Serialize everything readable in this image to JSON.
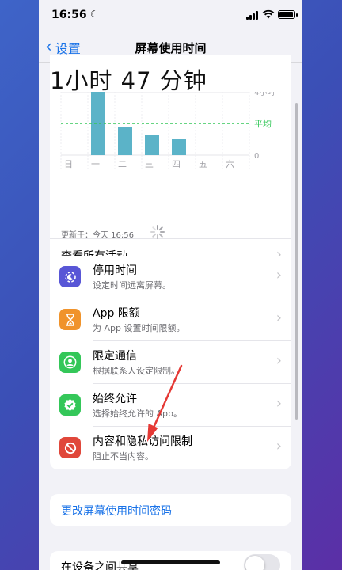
{
  "status_bar": {
    "time": "16:56",
    "moon": "☾"
  },
  "nav": {
    "back_label": "设置",
    "title": "屏幕使用时间"
  },
  "summary": {
    "total_time": "1小时 47 分钟",
    "see_all": "查看所有活动",
    "updated": "更新于：今天 16:56"
  },
  "chart_data": {
    "type": "bar",
    "categories": [
      "日",
      "一",
      "二",
      "三",
      "四",
      "五",
      "六"
    ],
    "values": [
      0,
      4,
      1.75,
      1.25,
      1.0,
      0,
      0
    ],
    "ylim": [
      0,
      4
    ],
    "yticks": [
      "4小时",
      "0"
    ],
    "average_label": "平均",
    "average_value": 2.0,
    "bar_color": "#5bb3c8",
    "average_color": "#34c759"
  },
  "menu": [
    {
      "title": "停用时间",
      "subtitle": "设定时间远离屏幕。",
      "icon": "downtime-icon",
      "color": "#5856d6"
    },
    {
      "title": "App 限额",
      "subtitle": "为 App 设置时间限额。",
      "icon": "hourglass-icon",
      "color": "#f0932b"
    },
    {
      "title": "限定通信",
      "subtitle": "根据联系人设定限制。",
      "icon": "contact-icon",
      "color": "#34c759"
    },
    {
      "title": "始终允许",
      "subtitle": "选择始终允许的 App。",
      "icon": "checkmark-badge-icon",
      "color": "#34c759"
    },
    {
      "title": "内容和隐私访问限制",
      "subtitle": "阻止不当内容。",
      "icon": "restriction-icon",
      "color": "#e0473a"
    }
  ],
  "passcode": {
    "label": "更改屏幕使用时间密码"
  },
  "share": {
    "label": "在设备之间共享"
  },
  "colors": {
    "accent": "#1a73e8",
    "annotation_arrow": "#e53935"
  }
}
